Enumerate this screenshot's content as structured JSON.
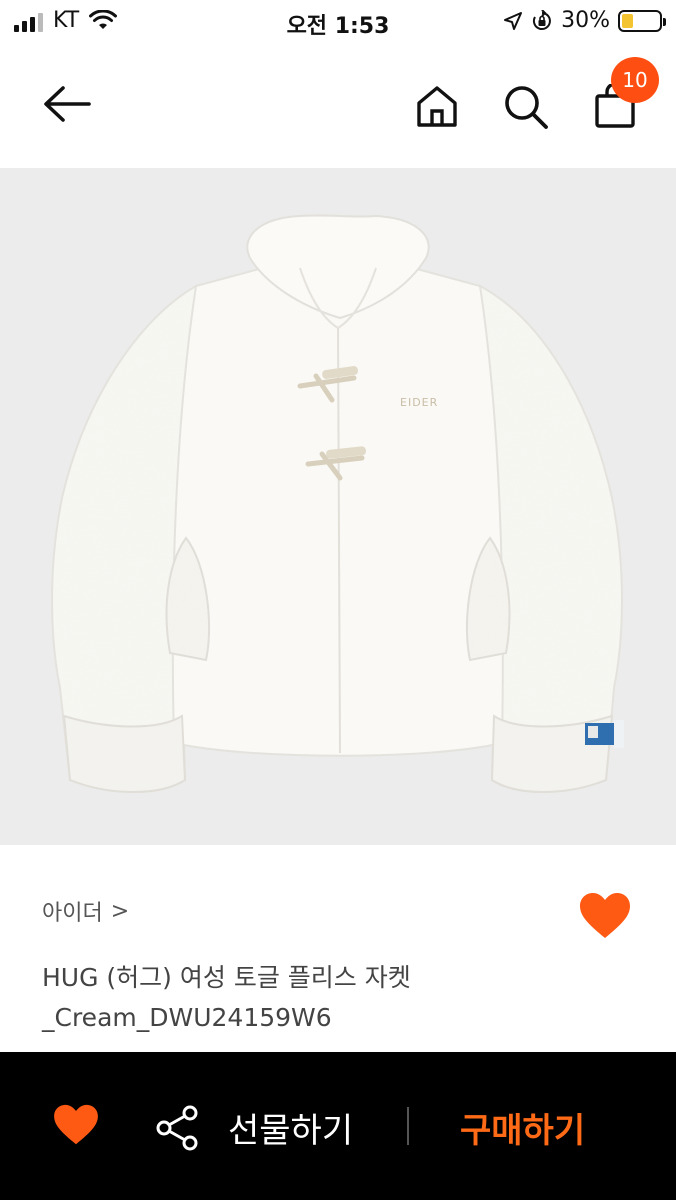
{
  "status_bar": {
    "carrier": "KT",
    "time": "오전 1:53",
    "battery_percent": "30%",
    "battery_level": 0.3,
    "icons": [
      "signal-icon",
      "wifi-icon",
      "location-icon",
      "orientation-lock-icon",
      "battery-icon"
    ]
  },
  "nav": {
    "icons": [
      "back-arrow-icon",
      "home-icon",
      "search-icon",
      "shopping-bag-icon"
    ],
    "cart_count": "10"
  },
  "product": {
    "brand": "아이더",
    "brand_chevron": ">",
    "name_line1": "HUG (허그) 여성 토글 플리스 자켓",
    "name_line2": "_Cream_DWU24159W6",
    "image_logo_text": "EIDER"
  },
  "bottom_bar": {
    "gift_label": "선물하기",
    "buy_label": "구매하기",
    "icons": [
      "heart-icon",
      "share-icon"
    ]
  },
  "colors": {
    "accent": "#ff5a14",
    "bottom_bar_bg": "#000000",
    "hero_bg": "#ececec"
  }
}
